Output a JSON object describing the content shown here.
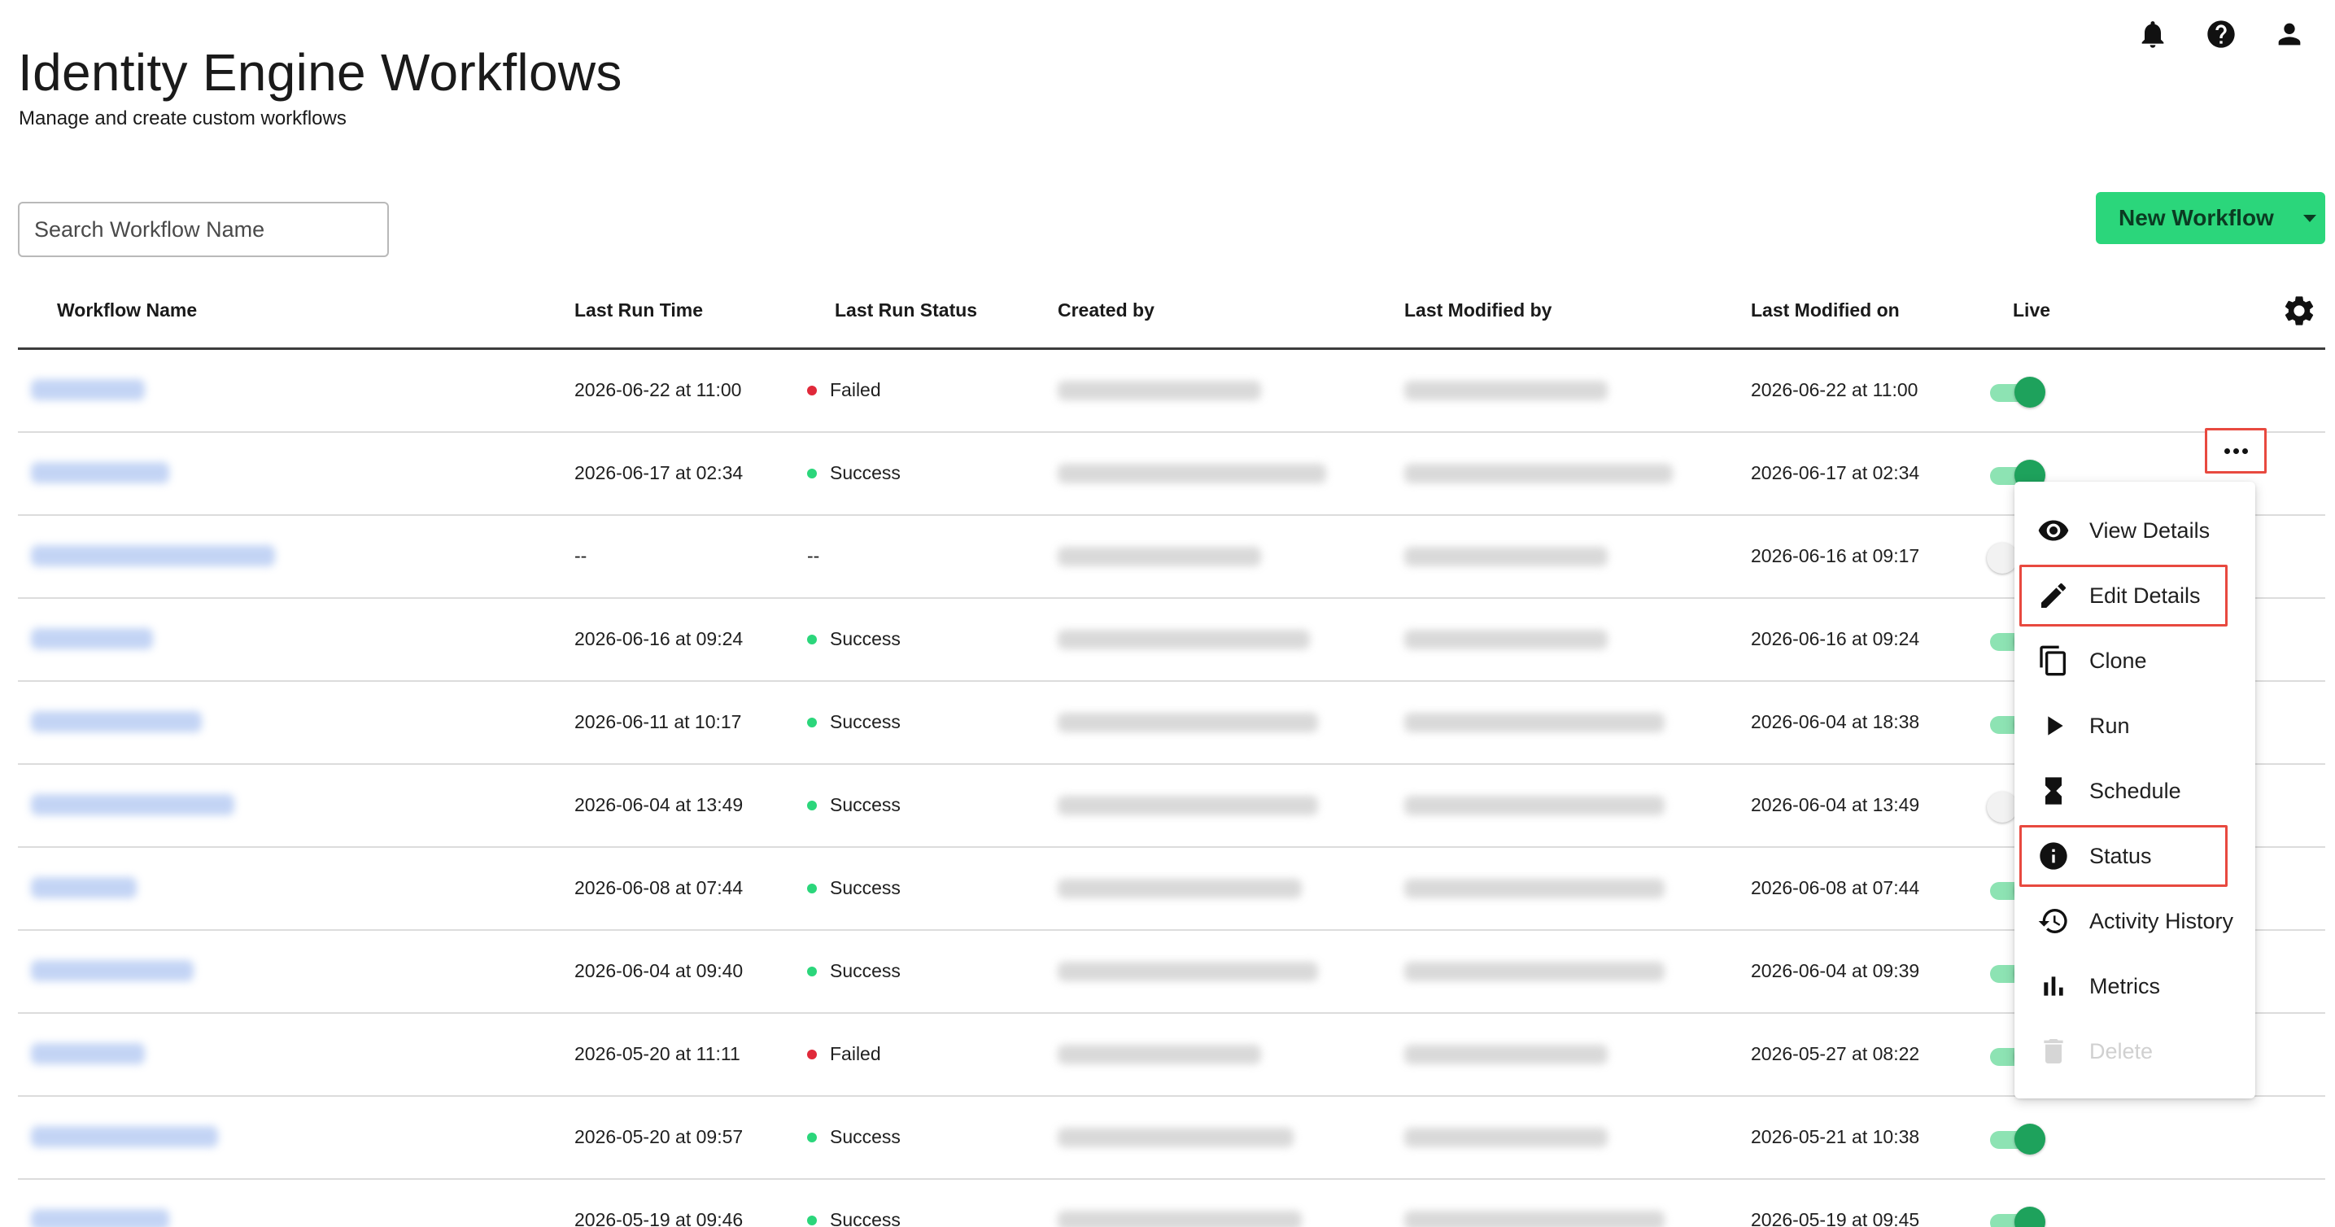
{
  "header": {
    "title": "Identity Engine Workflows",
    "subtitle": "Manage and create custom workflows",
    "icons": [
      "bell-icon",
      "help-icon",
      "user-icon"
    ]
  },
  "search": {
    "placeholder": "Search Workflow Name",
    "value": ""
  },
  "new_workflow": {
    "label": "New Workflow"
  },
  "colors": {
    "accent": "#2bd67b",
    "success": "#2bd67b",
    "failed": "#e0293a",
    "toggle_on": "#1ea25c",
    "highlight": "#e8493f"
  },
  "table": {
    "columns": [
      "Workflow Name",
      "Last Run Time",
      "Last Run Status",
      "Created by",
      "Last Modified by",
      "Last Modified on",
      "Live"
    ],
    "rows": [
      {
        "last_run_time": "2026-06-22 at 11:00",
        "status": "Failed",
        "last_modified_on": "2026-06-22 at 11:00",
        "live": true
      },
      {
        "last_run_time": "2026-06-17 at 02:34",
        "status": "Success",
        "last_modified_on": "2026-06-17 at 02:34",
        "live": true
      },
      {
        "last_run_time": "--",
        "status": "--",
        "last_modified_on": "2026-06-16 at 09:17",
        "live": false
      },
      {
        "last_run_time": "2026-06-16 at 09:24",
        "status": "Success",
        "last_modified_on": "2026-06-16 at 09:24",
        "live": true
      },
      {
        "last_run_time": "2026-06-11 at 10:17",
        "status": "Success",
        "last_modified_on": "2026-06-04 at 18:38",
        "live": true
      },
      {
        "last_run_time": "2026-06-04 at 13:49",
        "status": "Success",
        "last_modified_on": "2026-06-04 at 13:49",
        "live": false
      },
      {
        "last_run_time": "2026-06-08 at 07:44",
        "status": "Success",
        "last_modified_on": "2026-06-08 at 07:44",
        "live": true
      },
      {
        "last_run_time": "2026-06-04 at 09:40",
        "status": "Success",
        "last_modified_on": "2026-06-04 at 09:39",
        "live": true
      },
      {
        "last_run_time": "2026-05-20 at 11:11",
        "status": "Failed",
        "last_modified_on": "2026-05-27 at 08:22",
        "live": true
      },
      {
        "last_run_time": "2026-05-20 at 09:57",
        "status": "Success",
        "last_modified_on": "2026-05-21 at 10:38",
        "live": true
      },
      {
        "last_run_time": "2026-05-19 at 09:46",
        "status": "Success",
        "last_modified_on": "2026-05-19 at 09:45",
        "live": true
      }
    ]
  },
  "actions_menu": {
    "items": [
      {
        "label": "View Details",
        "icon": "eye-icon",
        "highlighted": false,
        "disabled": false
      },
      {
        "label": "Edit Details",
        "icon": "pencil-icon",
        "highlighted": true,
        "disabled": false
      },
      {
        "label": "Clone",
        "icon": "copy-icon",
        "highlighted": false,
        "disabled": false
      },
      {
        "label": "Run",
        "icon": "play-icon",
        "highlighted": false,
        "disabled": false
      },
      {
        "label": "Schedule",
        "icon": "hourglass-icon",
        "highlighted": false,
        "disabled": false
      },
      {
        "label": "Status",
        "icon": "info-icon",
        "highlighted": true,
        "disabled": false
      },
      {
        "label": "Activity History",
        "icon": "history-icon",
        "highlighted": false,
        "disabled": false
      },
      {
        "label": "Metrics",
        "icon": "bar-chart-icon",
        "highlighted": false,
        "disabled": false
      },
      {
        "label": "Delete",
        "icon": "trash-icon",
        "highlighted": false,
        "disabled": true
      }
    ]
  }
}
